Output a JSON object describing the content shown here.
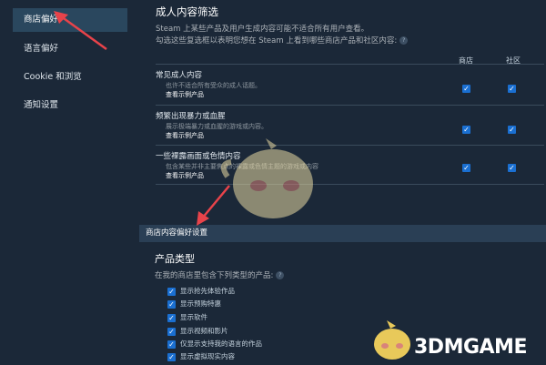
{
  "sidebar": {
    "items": [
      {
        "label": "商店偏好",
        "active": true
      },
      {
        "label": "语言偏好",
        "active": false
      },
      {
        "label": "Cookie 和浏览",
        "active": false
      },
      {
        "label": "通知设置",
        "active": false
      }
    ]
  },
  "mature": {
    "title": "成人内容筛选",
    "desc1": "Steam 上某些产品及用户生成内容可能不适合所有用户查看。",
    "desc2": "勾选这些复选框以表明您想在 Steam 上看到哪些商店产品和社区内容:",
    "help": "?",
    "col_store": "商店",
    "col_community": "社区",
    "rows": [
      {
        "title": "常见成人内容",
        "desc": "也许不适合所有受众的成人话题。",
        "link": "查看示例产品",
        "store": true,
        "community": true
      },
      {
        "title": "频繁出现暴力或血腥",
        "desc": "展示极端暴力或血腥的游戏或内容。",
        "link": "查看示例产品",
        "store": true,
        "community": true
      },
      {
        "title": "一些裸露画面或色情内容",
        "desc": "包含某些并非主要焦点的裸露或色情主题的游戏或内容",
        "link": "查看示例产品",
        "store": true,
        "community": true
      }
    ]
  },
  "store_prefs": {
    "section_title": "商店内容偏好设置",
    "product_types_title": "产品类型",
    "product_types_desc": "在我的商店里包含下列类型的产品:",
    "help": "?",
    "options": [
      {
        "label": "显示抢先体验作品",
        "checked": true
      },
      {
        "label": "显示预购特惠",
        "checked": true
      },
      {
        "label": "显示软件",
        "checked": true
      },
      {
        "label": "显示视频和影片",
        "checked": true
      },
      {
        "label": "仅显示支持我的语言的作品",
        "checked": true
      },
      {
        "label": "显示虚拟现实内容",
        "checked": true
      }
    ]
  },
  "watermark": {
    "text": "3DMGAME"
  },
  "colors": {
    "background": "#1b2838",
    "active_item": "#2a475e",
    "checkbox": "#1a6fd1",
    "arrow": "#e8434a",
    "section_bar": "#2a3f55"
  }
}
